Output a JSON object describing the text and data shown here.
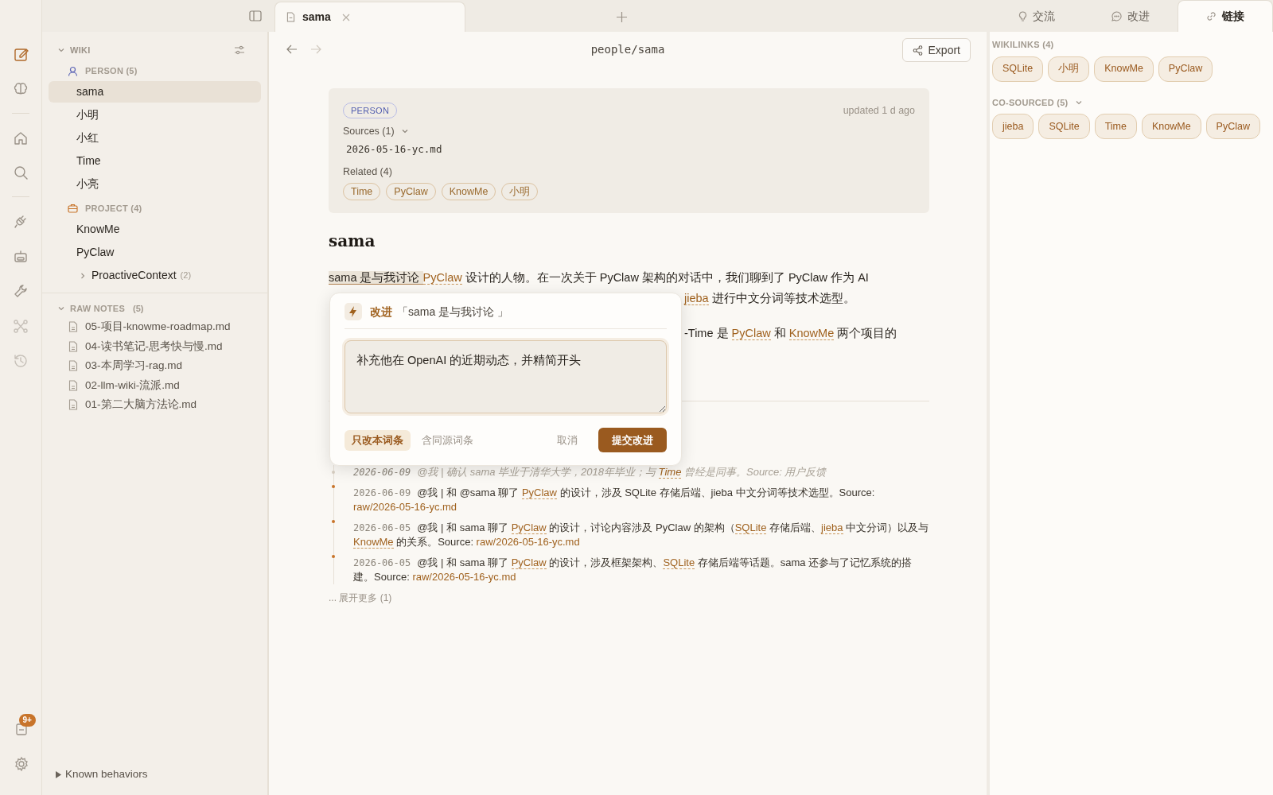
{
  "rail": {
    "items": [
      {
        "selected": true,
        "disabled": false
      },
      {
        "selected": false,
        "disabled": false
      },
      {
        "selected": false,
        "disabled": false
      },
      {
        "selected": false,
        "disabled": false
      },
      {
        "selected": false,
        "disabled": false
      },
      {
        "selected": false,
        "disabled": false
      },
      {
        "selected": false,
        "disabled": false
      },
      {
        "selected": false,
        "disabled": true
      },
      {
        "selected": false,
        "disabled": true
      }
    ],
    "notes_badge": "9+"
  },
  "sidebar": {
    "wiki": {
      "title": "WIKI",
      "expanded": true,
      "groups": [
        {
          "label": "PERSON (5)",
          "kind": "person",
          "items": [
            {
              "label": "sama",
              "selected": true
            },
            {
              "label": "小明",
              "selected": false
            },
            {
              "label": "小红",
              "selected": false
            },
            {
              "label": "Time",
              "selected": false
            },
            {
              "label": "小亮",
              "selected": false
            }
          ]
        },
        {
          "label": "PROJECT (4)",
          "kind": "project",
          "items": [
            {
              "label": "KnowMe",
              "selected": false
            },
            {
              "label": "PyClaw",
              "selected": false
            },
            {
              "label": "ProactiveContext",
              "count": "(2)",
              "kind": "folder",
              "expanded": false,
              "selected": false
            }
          ]
        }
      ]
    },
    "raw_notes": {
      "title": "RAW NOTES",
      "count": "(5)",
      "expanded": true,
      "items": [
        "05-项目-knowme-roadmap.md",
        "04-读书笔记-思考快与慢.md",
        "03-本周学习-rag.md",
        "02-llm-wiki-流派.md",
        "01-第二大脑方法论.md"
      ]
    },
    "known_behaviors": {
      "label": "Known behaviors",
      "expanded": false
    }
  },
  "tabs": [
    {
      "label": "sama",
      "selected": true
    }
  ],
  "toolbar": {
    "path": "people/sama",
    "export": "Export"
  },
  "card": {
    "badge": "PERSON",
    "updated": "updated 1 d ago",
    "sources_label": "Sources (1)",
    "sources_expanded": true,
    "sources": [
      "2026-05-16-yc.md"
    ],
    "related_label": "Related (4)",
    "related": [
      "Time",
      "PyClaw",
      "KnowMe",
      "小明"
    ]
  },
  "heading": "sama",
  "paragraphs": [
    {
      "lines": [
        {
          "indent": false,
          "segments": [
            {
              "kind": "selection",
              "text": "sama 是与我讨论 "
            },
            {
              "kind": "link",
              "text": "PyClaw"
            },
            {
              "kind": "plain",
              "text": " 设计的人物。在一次关于 PyClaw 架构的对话中，我们聊到了 PyClaw 作为 AI"
            }
          ]
        },
        {
          "indent": true,
          "segments": [
            {
              "kind": "link",
              "text": "jieba"
            },
            {
              "kind": "plain",
              "text": " 进行中文分词等技术选型。"
            }
          ]
        }
      ]
    },
    {
      "lines": [
        {
          "indent": true,
          "segments": [
            {
              "kind": "plain",
              "text": "-Time 是 "
            },
            {
              "kind": "link",
              "text": "PyClaw"
            },
            {
              "kind": "plain",
              "text": " 和 "
            },
            {
              "kind": "link",
              "text": "KnowMe"
            },
            {
              "kind": "plain",
              "text": " 两个项目的"
            }
          ]
        }
      ]
    }
  ],
  "timeline": [
    {
      "date": "2026-06-09",
      "kind": "feedback",
      "segments": [
        {
          "kind": "plain",
          "text": "@我 | 确认 sama 毕业于清华大学，2018年毕业；与 "
        },
        {
          "kind": "wikilink",
          "text": "Time"
        },
        {
          "kind": "plain",
          "text": " 曾经是同事。Source: 用户反馈"
        }
      ]
    },
    {
      "date": "2026-06-09",
      "kind": "normal",
      "segments": [
        {
          "kind": "plain",
          "text": "@我 | 和 @sama 聊了 "
        },
        {
          "kind": "wikilink",
          "text": "PyClaw"
        },
        {
          "kind": "plain",
          "text": " 的设计，涉及 SQLite 存储后端、jieba 中文分词等技术选型。Source: "
        },
        {
          "kind": "source",
          "text": "raw/2026-05-16-yc.md"
        }
      ]
    },
    {
      "date": "2026-06-05",
      "kind": "normal",
      "segments": [
        {
          "kind": "plain",
          "text": "@我 | 和 sama 聊了 "
        },
        {
          "kind": "wikilink",
          "text": "PyClaw"
        },
        {
          "kind": "plain",
          "text": " 的设计，讨论内容涉及 PyClaw 的架构（"
        },
        {
          "kind": "wikilink",
          "text": "SQLite"
        },
        {
          "kind": "plain",
          "text": " 存储后端、"
        },
        {
          "kind": "wikilink",
          "text": "jieba"
        },
        {
          "kind": "plain",
          "text": " 中文分词）以及与 "
        },
        {
          "kind": "wikilink",
          "text": "KnowMe"
        },
        {
          "kind": "plain",
          "text": " 的关系。Source: "
        },
        {
          "kind": "source",
          "text": "raw/2026-05-16-yc.md"
        }
      ]
    },
    {
      "date": "2026-06-05",
      "kind": "normal",
      "segments": [
        {
          "kind": "plain",
          "text": "@我 | 和 sama 聊了 "
        },
        {
          "kind": "wikilink",
          "text": "PyClaw"
        },
        {
          "kind": "plain",
          "text": " 的设计，涉及框架架构、"
        },
        {
          "kind": "wikilink",
          "text": "SQLite"
        },
        {
          "kind": "plain",
          "text": " 存储后端等话题。sama 还参与了记忆系统的搭建。Source: "
        },
        {
          "kind": "source",
          "text": "raw/2026-05-16-yc.md"
        }
      ]
    }
  ],
  "show_more": "... 展开更多 (1)",
  "popup": {
    "title": "改进",
    "quote": "「sama 是与我讨论 」",
    "value": "补充他在 OpenAI 的近期动态，并精简开头",
    "scopes": [
      {
        "label": "只改本词条",
        "selected": true
      },
      {
        "label": "含同源词条",
        "selected": false
      }
    ],
    "cancel": "取消",
    "submit": "提交改进"
  },
  "right_tabs": [
    {
      "label": "交流",
      "selected": false
    },
    {
      "label": "改进",
      "selected": false
    },
    {
      "label": "链接",
      "selected": true
    }
  ],
  "wikilinks": {
    "title": "WIKILINKS (4)",
    "items": [
      "SQLite",
      "小明",
      "KnowMe",
      "PyClaw"
    ]
  },
  "co_sourced": {
    "title": "CO-SOURCED (5)",
    "expanded": true,
    "items": [
      "jieba",
      "SQLite",
      "Time",
      "KnowMe",
      "PyClaw"
    ]
  }
}
